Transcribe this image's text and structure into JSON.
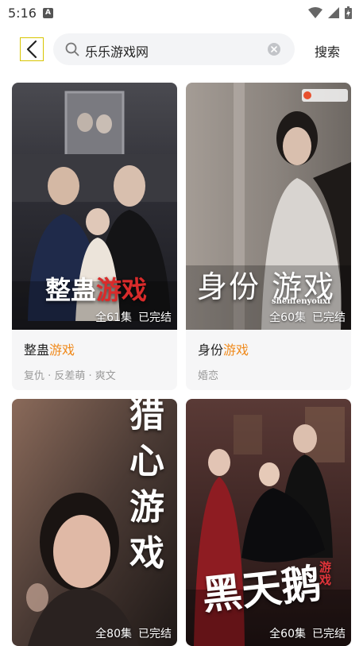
{
  "status_bar": {
    "time": "5:16",
    "notification_icon": "A"
  },
  "header": {
    "search_query": "乐乐游戏网",
    "search_button": "搜索"
  },
  "results": [
    {
      "title_prefix": "整蛊",
      "title_highlight": "游戏",
      "cover_title_a": "整蛊",
      "cover_title_b": "游戏",
      "episodes": "全61集",
      "status": "已完结",
      "tags": "复仇 · 反差萌 · 爽文"
    },
    {
      "title_prefix": "身份",
      "title_highlight": "游戏",
      "cover_title_a": "身份 游戏",
      "cover_subtitle": "shenfenyouxi",
      "episodes": "全60集",
      "status": "已完结",
      "tags": "婚恋"
    },
    {
      "cover_title_a": "猎心游戏",
      "episodes": "全80集",
      "status": "已完结"
    },
    {
      "cover_title_a": "黑天鹅",
      "cover_title_b": "游戏",
      "episodes": "全60集",
      "status": "已完结"
    }
  ],
  "colors": {
    "highlight": "#f08a1c",
    "search_bg": "#f3f4f6",
    "card_bg": "#f6f6f7"
  }
}
